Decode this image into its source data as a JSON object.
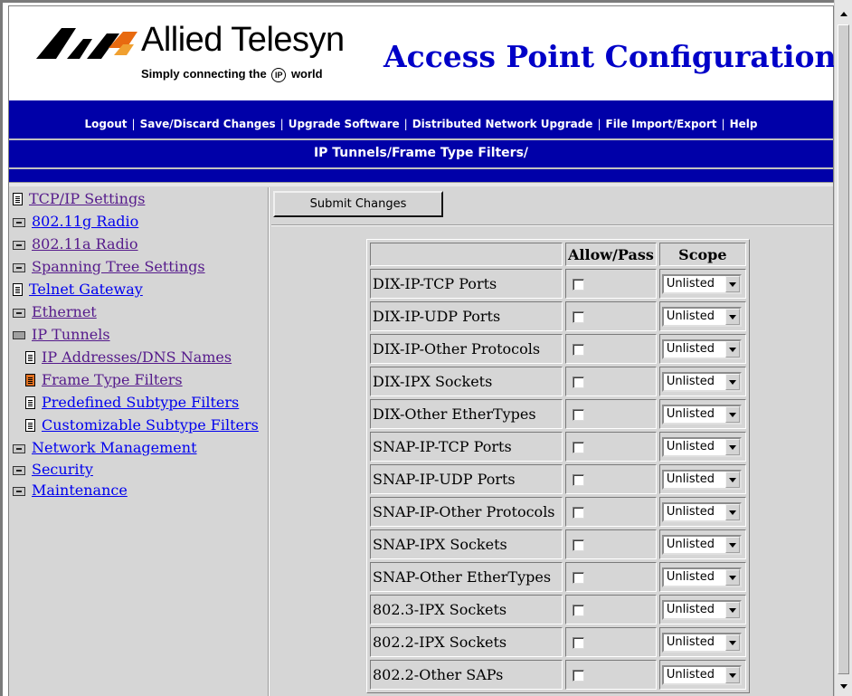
{
  "header": {
    "brand_name": "Allied Telesyn",
    "brand_tagline_pre": "Simply connecting the",
    "brand_tagline_ip": "IP",
    "brand_tagline_post": "world",
    "app_title": "Access Point Configuration",
    "brand_color": "#0000c8"
  },
  "nav": {
    "links": [
      "Logout",
      "Save/Discard Changes",
      "Upgrade Software",
      "Distributed Network Upgrade",
      "File Import/Export",
      "Help"
    ],
    "separator": "|",
    "breadcrumb": "IP Tunnels/Frame Type Filters/"
  },
  "sidebar": {
    "items": [
      {
        "label": "TCP/IP Settings",
        "icon": "document-icon"
      },
      {
        "label": "802.11g Radio",
        "icon": "folder-closed-icon"
      },
      {
        "label": "802.11a Radio",
        "icon": "folder-closed-icon"
      },
      {
        "label": "Spanning Tree Settings",
        "icon": "folder-closed-icon"
      },
      {
        "label": "Telnet Gateway",
        "icon": "document-icon"
      },
      {
        "label": "Ethernet",
        "icon": "folder-closed-icon"
      },
      {
        "label": "IP Tunnels",
        "icon": "folder-open-icon"
      },
      {
        "label": "IP Addresses/DNS Names",
        "icon": "document-icon"
      },
      {
        "label": "Frame Type Filters",
        "icon": "document-selected-icon"
      },
      {
        "label": "Predefined Subtype Filters",
        "icon": "document-icon"
      },
      {
        "label": "Customizable Subtype Filters",
        "icon": "document-icon"
      },
      {
        "label": "Network Management",
        "icon": "folder-closed-icon"
      },
      {
        "label": "Security",
        "icon": "folder-closed-icon"
      },
      {
        "label": "Maintenance",
        "icon": "folder-closed-icon"
      }
    ]
  },
  "main": {
    "submit_label": "Submit Changes",
    "table": {
      "headers": [
        "",
        "Allow/Pass",
        "Scope"
      ],
      "rows": [
        {
          "name": "DIX-IP-TCP Ports",
          "allow": false,
          "scope": "Unlisted"
        },
        {
          "name": "DIX-IP-UDP Ports",
          "allow": false,
          "scope": "Unlisted"
        },
        {
          "name": "DIX-IP-Other Protocols",
          "allow": false,
          "scope": "Unlisted"
        },
        {
          "name": "DIX-IPX Sockets",
          "allow": false,
          "scope": "Unlisted"
        },
        {
          "name": "DIX-Other EtherTypes",
          "allow": false,
          "scope": "Unlisted"
        },
        {
          "name": "SNAP-IP-TCP Ports",
          "allow": false,
          "scope": "Unlisted"
        },
        {
          "name": "SNAP-IP-UDP Ports",
          "allow": false,
          "scope": "Unlisted"
        },
        {
          "name": "SNAP-IP-Other Protocols",
          "allow": false,
          "scope": "Unlisted"
        },
        {
          "name": "SNAP-IPX Sockets",
          "allow": false,
          "scope": "Unlisted"
        },
        {
          "name": "SNAP-Other EtherTypes",
          "allow": false,
          "scope": "Unlisted"
        },
        {
          "name": "802.3-IPX Sockets",
          "allow": false,
          "scope": "Unlisted"
        },
        {
          "name": "802.2-IPX Sockets",
          "allow": false,
          "scope": "Unlisted"
        },
        {
          "name": "802.2-Other SAPs",
          "allow": false,
          "scope": "Unlisted"
        }
      ]
    }
  }
}
